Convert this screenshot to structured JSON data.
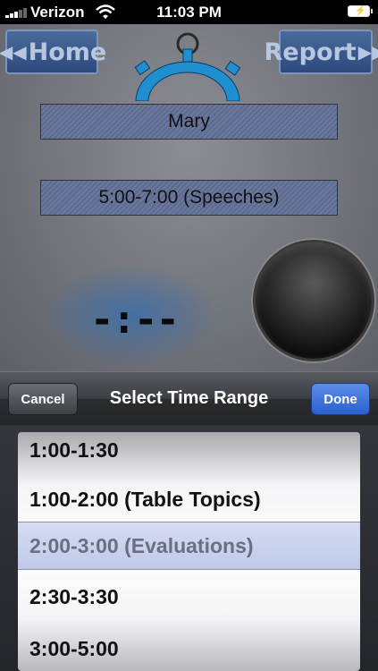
{
  "status_bar": {
    "carrier": "Verizon",
    "time": "11:03 PM"
  },
  "nav": {
    "home_label": "Home",
    "report_label": "Report"
  },
  "form": {
    "speaker_name": "Mary",
    "time_range": "5:00-7:00 (Speeches)"
  },
  "timer": {
    "display": "-:--"
  },
  "toolbar": {
    "title": "Select Time Range",
    "cancel_label": "Cancel",
    "done_label": "Done"
  },
  "picker": {
    "options": [
      "1:00-1:30",
      "1:00-2:00 (Table Topics)",
      "2:00-3:00 (Evaluations)",
      "2:30-3:30",
      "3:00-5:00"
    ],
    "selected": "2:00-3:00 (Evaluations)"
  },
  "colors": {
    "nav_button": "#2c4a7d",
    "done_button": "#2a5fcf",
    "stopwatch_accent": "#1f8fd0"
  }
}
